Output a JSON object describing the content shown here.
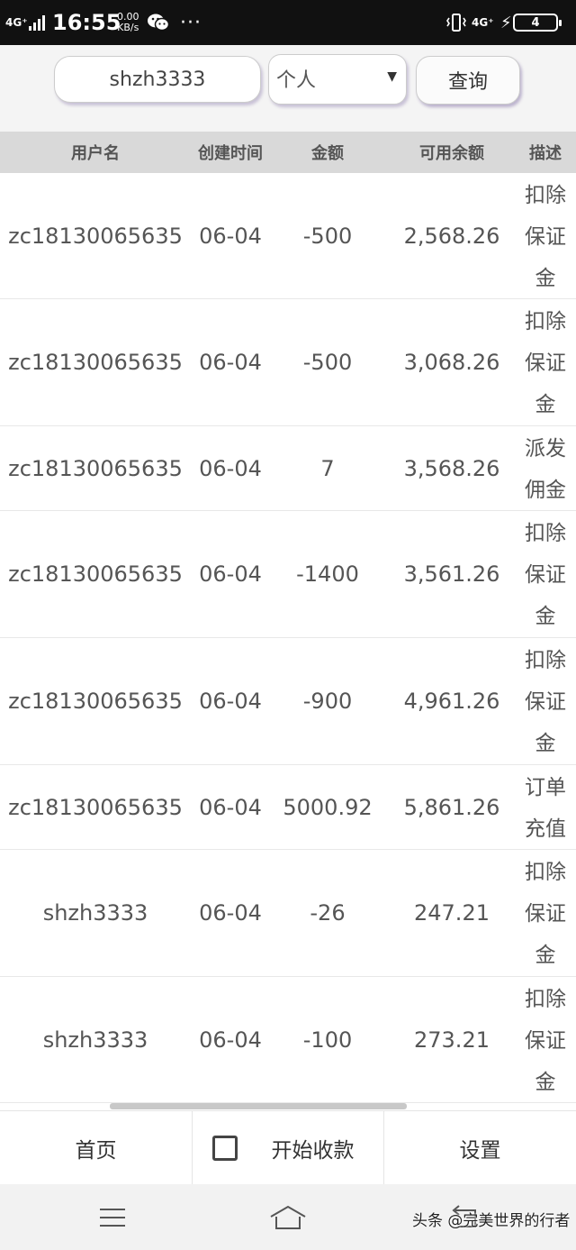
{
  "status_bar": {
    "network": "4G⁺",
    "time": "16:55",
    "speed_value": "0.00",
    "speed_unit": "KB/s",
    "dots": "···",
    "network2": "4G⁺",
    "battery": "4"
  },
  "search": {
    "value": "shzh3333",
    "type_selected": "个人",
    "query_label": "查询"
  },
  "table": {
    "headers": [
      "用户名",
      "创建时间",
      "金额",
      "可用余额",
      "描述"
    ],
    "rows": [
      {
        "user": "zc18130065635",
        "date": "06-04",
        "amount": "-500",
        "balance": "2,568.26",
        "desc": "扣除保证金"
      },
      {
        "user": "zc18130065635",
        "date": "06-04",
        "amount": "-500",
        "balance": "3,068.26",
        "desc": "扣除保证金"
      },
      {
        "user": "zc18130065635",
        "date": "06-04",
        "amount": "7",
        "balance": "3,568.26",
        "desc": "派发佣金"
      },
      {
        "user": "zc18130065635",
        "date": "06-04",
        "amount": "-1400",
        "balance": "3,561.26",
        "desc": "扣除保证金"
      },
      {
        "user": "zc18130065635",
        "date": "06-04",
        "amount": "-900",
        "balance": "4,961.26",
        "desc": "扣除保证金"
      },
      {
        "user": "zc18130065635",
        "date": "06-04",
        "amount": "5000.92",
        "balance": "5,861.26",
        "desc": "订单充值"
      },
      {
        "user": "shzh3333",
        "date": "06-04",
        "amount": "-26",
        "balance": "247.21",
        "desc": "扣除保证金"
      },
      {
        "user": "shzh3333",
        "date": "06-04",
        "amount": "-100",
        "balance": "273.21",
        "desc": "扣除保证金"
      }
    ]
  },
  "tabbar": {
    "home": "首页",
    "start_collect": "开始收款",
    "settings": "设置"
  },
  "watermark": "头条 @完美世界的行者"
}
